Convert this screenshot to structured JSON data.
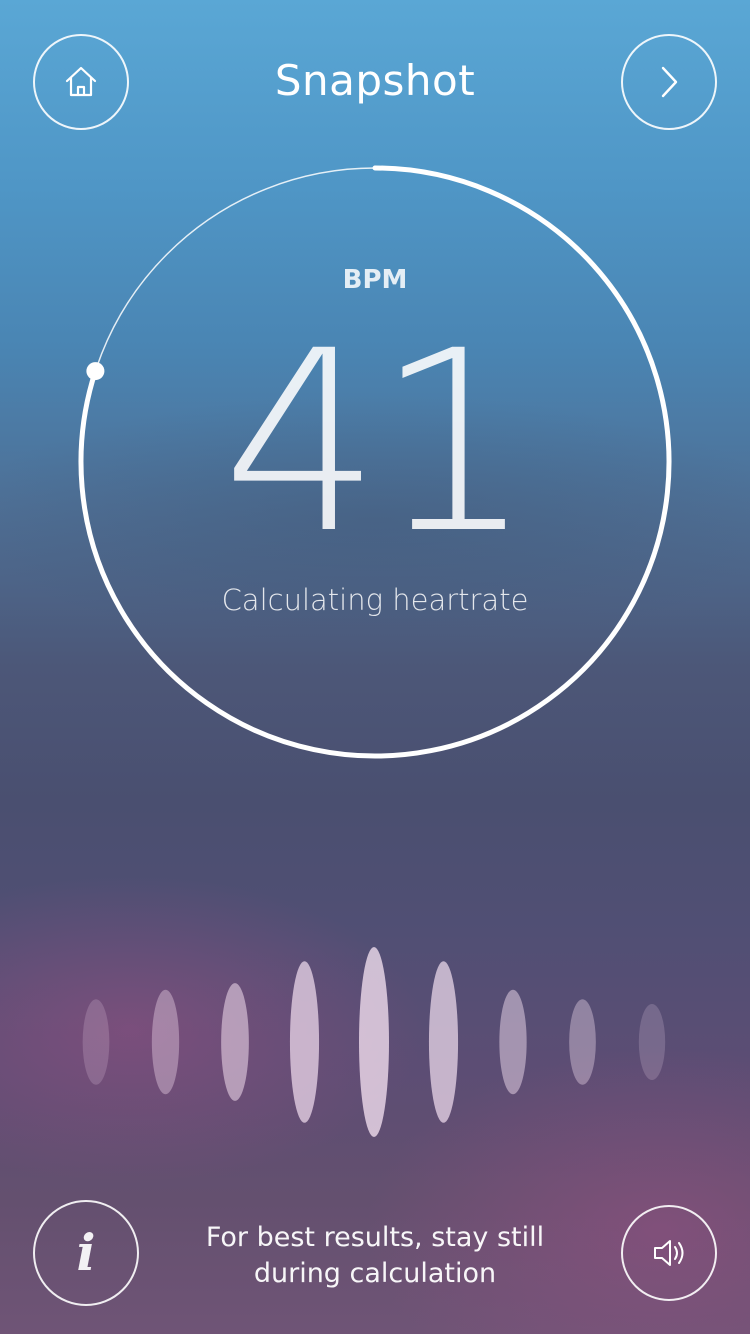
{
  "header": {
    "title": "Snapshot",
    "home_icon": "home-icon",
    "next_icon": "chevron-right-icon"
  },
  "meter": {
    "unit_label": "BPM",
    "value": "41",
    "status": "Calculating heartrate",
    "progress_fraction": 0.8
  },
  "footer": {
    "info_icon": "info-icon",
    "info_glyph": "i",
    "hint": "For best results, stay still during calculation",
    "sound_icon": "speaker-icon"
  },
  "wave": {
    "levels": [
      0.45,
      0.55,
      0.62,
      0.85,
      1.0,
      0.85,
      0.55,
      0.45,
      0.4
    ],
    "opacities": [
      0.18,
      0.35,
      0.5,
      0.65,
      0.72,
      0.65,
      0.45,
      0.35,
      0.18
    ]
  }
}
